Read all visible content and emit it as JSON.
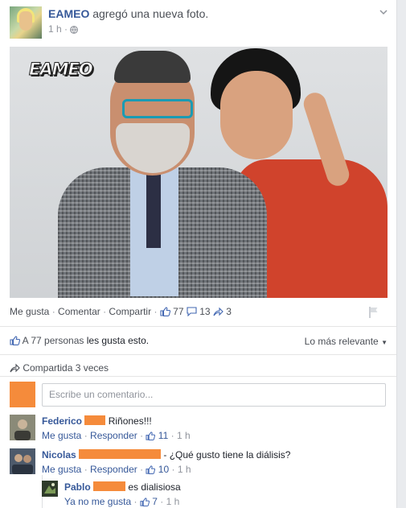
{
  "post": {
    "author": "EAMEO",
    "action": "agregó una nueva foto.",
    "time": "1 h",
    "privacy_icon": "globe-icon"
  },
  "photo": {
    "logo_text": "EAMEO"
  },
  "actions": {
    "like": "Me gusta",
    "comment": "Comentar",
    "share": "Compartir",
    "like_count": "77",
    "comment_count": "13",
    "share_count": "3"
  },
  "likes_summary": {
    "prefix": "A 77 personas",
    "suffix": "les gusta esto.",
    "sort": "Lo más relevante"
  },
  "shared": "Compartida 3 veces",
  "composer": {
    "placeholder": "Escribe un comentario..."
  },
  "comments": [
    {
      "name": "Federico",
      "text": "Riñones!!!",
      "like": "Me gusta",
      "reply": "Responder",
      "likes": "11",
      "time": "1 h"
    },
    {
      "name": "Nicolas",
      "text": "- ¿Qué gusto tiene la diálisis?",
      "like": "Me gusta",
      "reply": "Responder",
      "likes": "10",
      "time": "1 h"
    },
    {
      "name": "Pablo",
      "text": "es dialisiosa",
      "unlike": "Ya no me gusta",
      "likes": "7",
      "time": "1 h"
    }
  ],
  "colors": {
    "link": "#365899",
    "muted": "#90949c",
    "redaction": "#f58b3b"
  }
}
